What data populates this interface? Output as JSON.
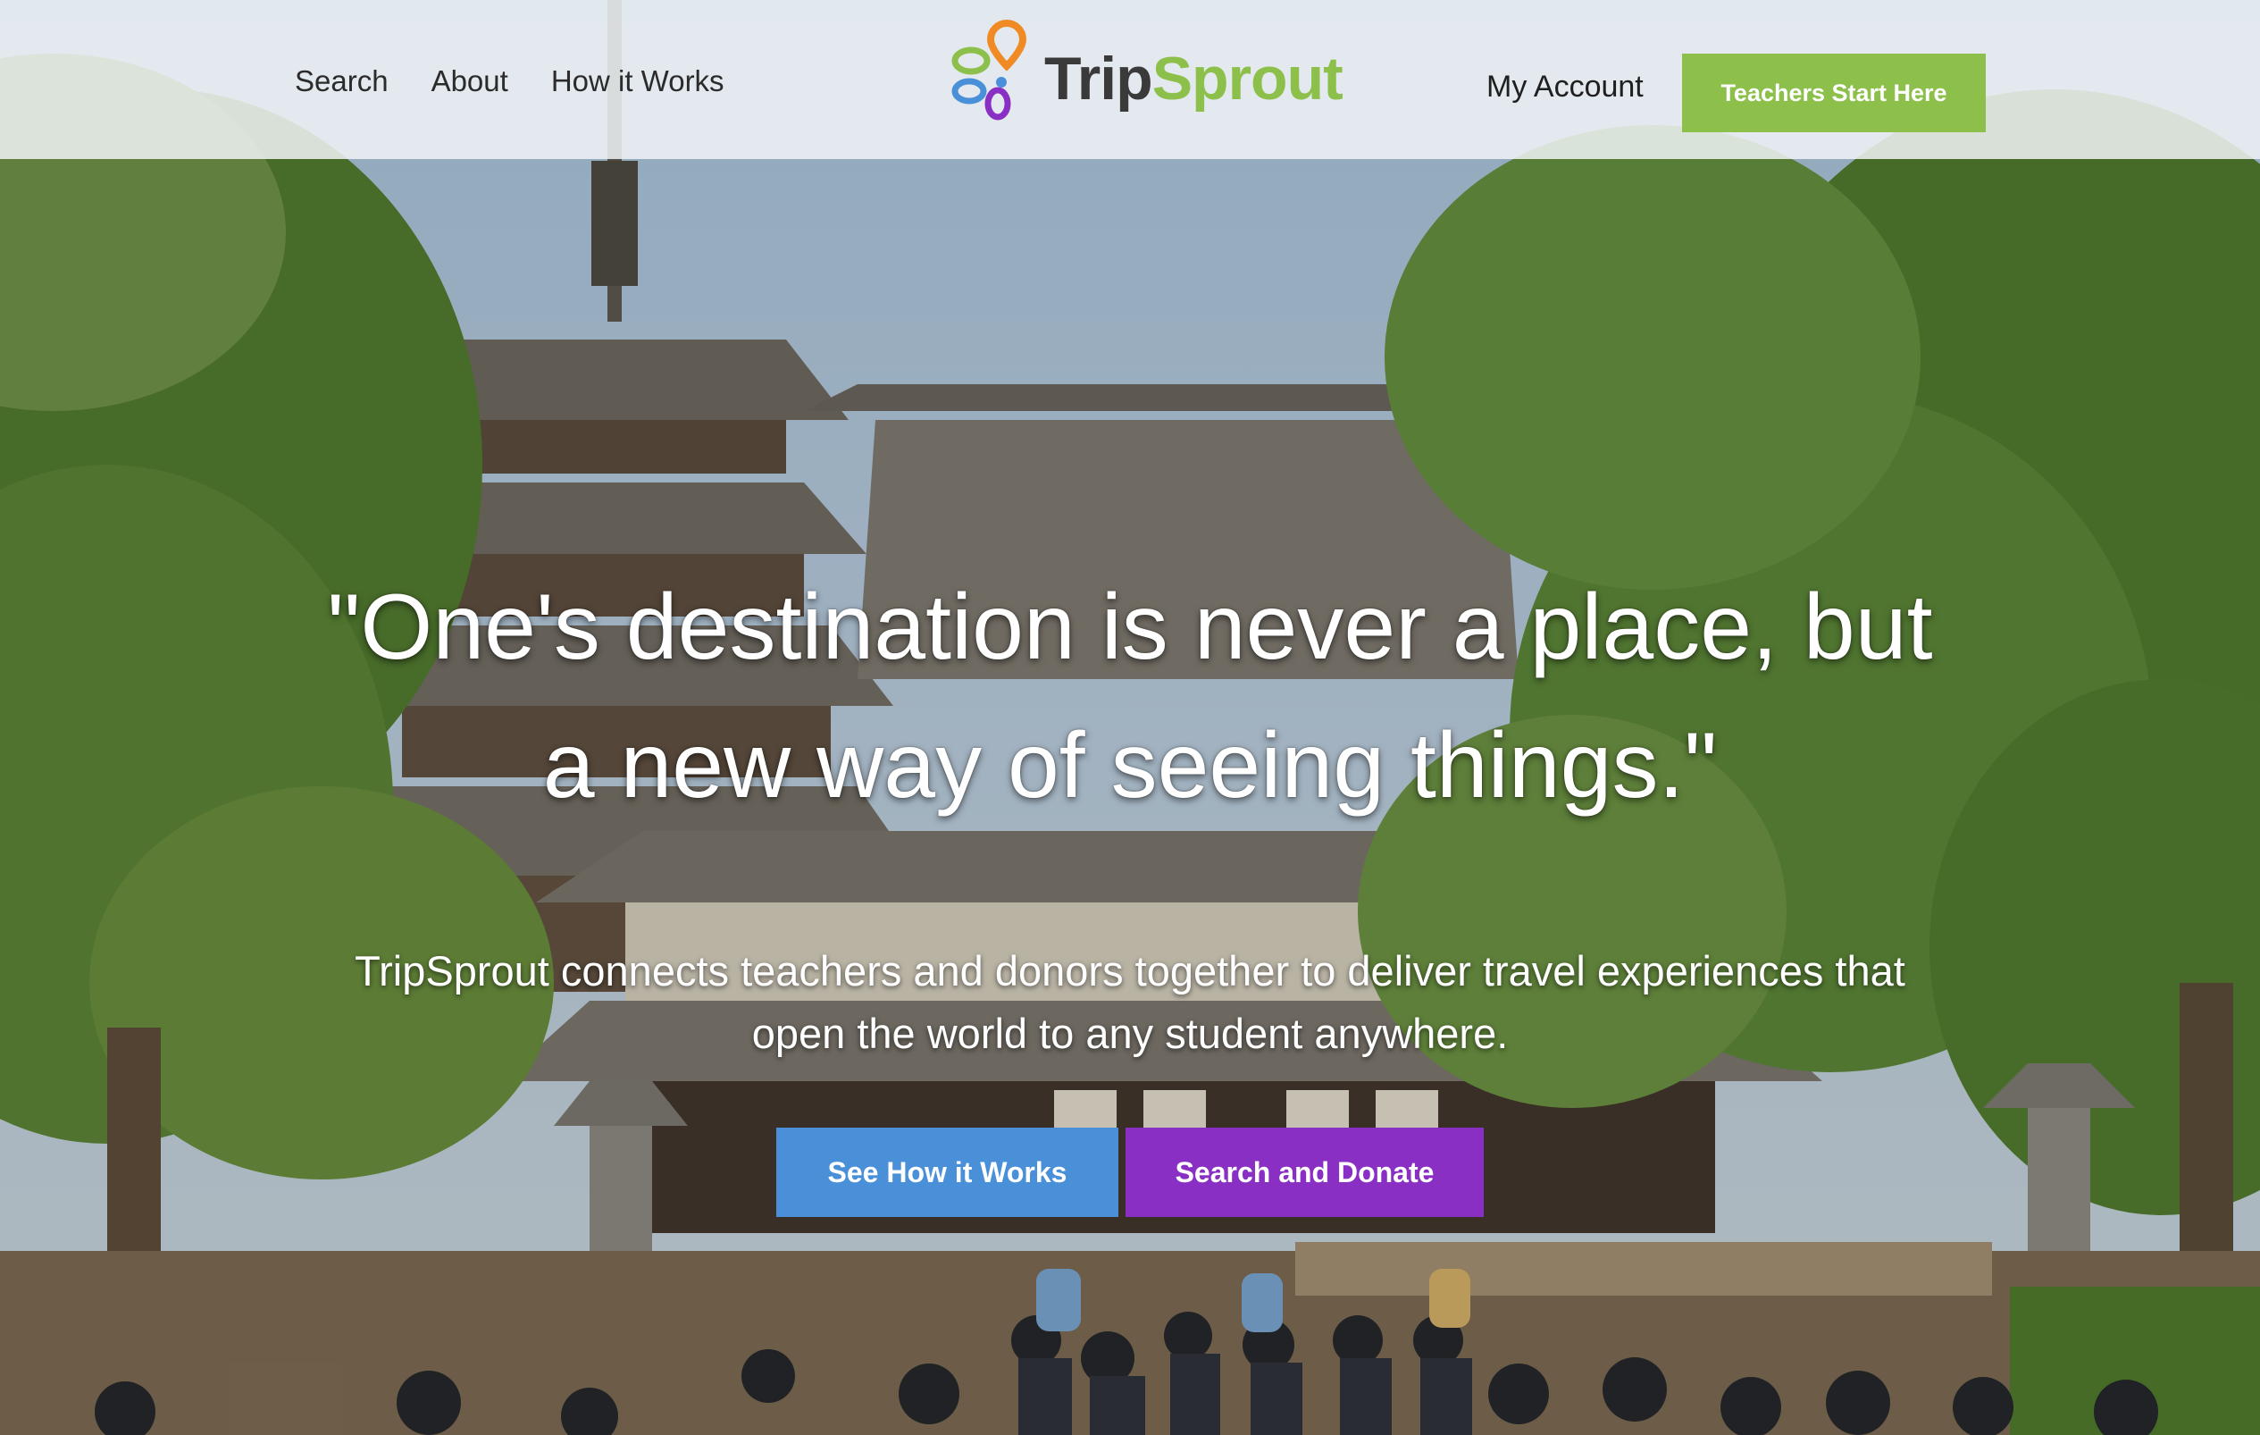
{
  "header": {
    "nav_left": [
      "Search",
      "About",
      "How it Works"
    ],
    "logo": {
      "trip": "Trip",
      "sprout": "Sprout",
      "icon": "tripsprout-logo-icon"
    },
    "account_label": "My Account",
    "cta_label": "Teachers Start Here"
  },
  "hero": {
    "quote_line1": "\"One's destination is never a place, but",
    "quote_line2": "a new way of seeing things.\"",
    "subtitle_line1": "TripSprout connects teachers and donors together to deliver travel experiences that",
    "subtitle_line2": "open the world to any student anywhere.",
    "buttons": {
      "how": "See How it Works",
      "donate": "Search and Donate"
    },
    "background": "photo of Horyu-ji temple pagoda with pine trees and students"
  },
  "colors": {
    "green": "#8cc04a",
    "blue": "#4a90d9",
    "purple": "#8a2fc3",
    "header_bg": "#f0f3f6"
  }
}
